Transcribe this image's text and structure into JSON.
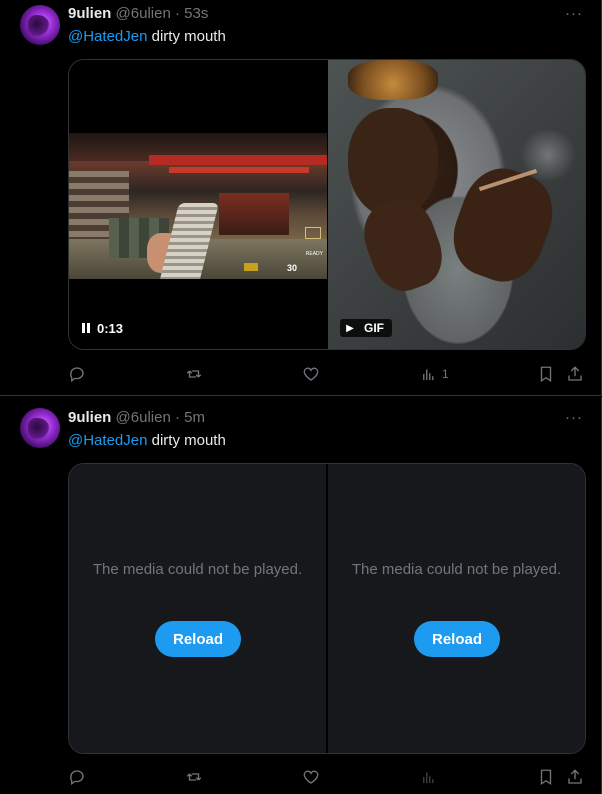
{
  "tweets": [
    {
      "display_name": "9ulien",
      "handle": "@6ulien",
      "separator": "·",
      "time": "53s",
      "more": "···",
      "mention": "@HatedJen",
      "text": " dirty mouth",
      "media": {
        "video": {
          "duration": "0:13",
          "state": "paused-icon",
          "hud_ammo": "30",
          "hud_ready": "READY"
        },
        "gif": {
          "badge": "GIF",
          "play_icon": "▶"
        }
      },
      "actions": {
        "reply": "",
        "retweet": "",
        "like": "",
        "views": "1",
        "bookmark": "",
        "share": ""
      }
    },
    {
      "display_name": "9ulien",
      "handle": "@6ulien",
      "separator": "·",
      "time": "5m",
      "more": "···",
      "mention": "@HatedJen",
      "text": " dirty mouth",
      "media": {
        "left": {
          "message": "The media could not be played.",
          "button": "Reload"
        },
        "right": {
          "message": "The media could not be played.",
          "button": "Reload"
        }
      },
      "actions": {
        "reply": "",
        "retweet": "",
        "like": "",
        "views": "",
        "bookmark": "",
        "share": ""
      }
    }
  ],
  "colors": {
    "accent": "#1d9bf0",
    "muted": "#71767b",
    "text": "#e7e9ea",
    "bg": "#000000",
    "error_pane": "#16181c"
  }
}
